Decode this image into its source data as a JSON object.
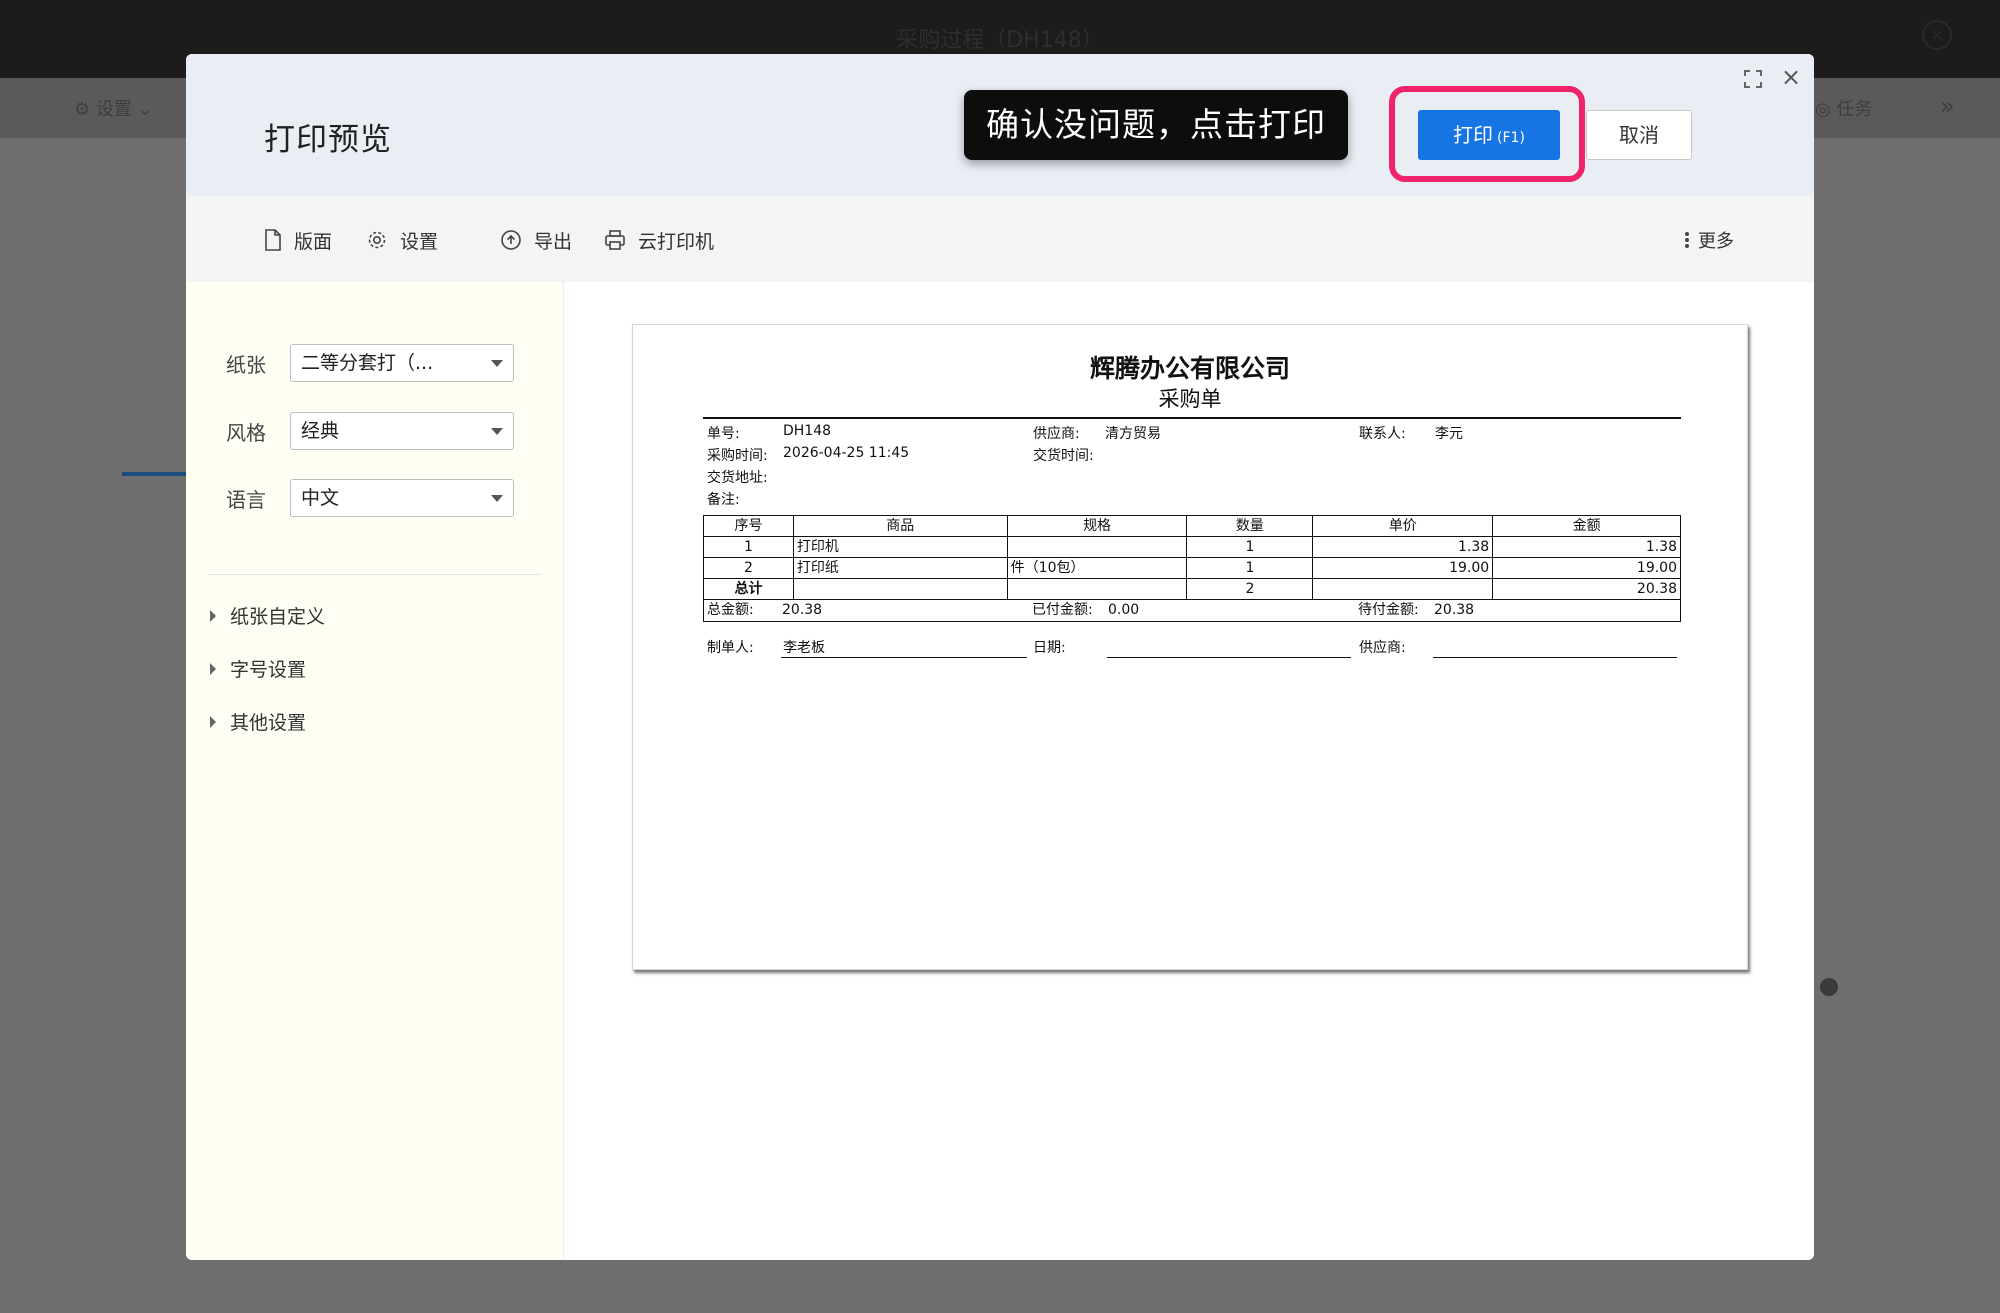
{
  "background": {
    "window_title": "采购过程（DH148）",
    "left_tool": "⚙ 设置 ⌄",
    "right_tool": "◎ 任务"
  },
  "modal": {
    "title": "打印预览",
    "callout": "确认没问题，点击打印",
    "print_label": "打印",
    "print_shortcut": "(F1)",
    "cancel_label": "取消"
  },
  "toolbar": {
    "layout": "版面",
    "settings": "设置",
    "export": "导出",
    "cloud_printer": "云打印机",
    "more": "更多"
  },
  "sidebar": {
    "paper_label": "纸张",
    "paper_value": "二等分套打（...",
    "style_label": "风格",
    "style_value": "经典",
    "language_label": "语言",
    "language_value": "中文",
    "sections": [
      "纸张自定义",
      "字号设置",
      "其他设置"
    ]
  },
  "document": {
    "company": "辉腾办公有限公司",
    "type": "采购单",
    "order_no_label": "单号:",
    "order_no": "DH148",
    "supplier_label": "供应商:",
    "supplier": "清方贸易",
    "contact_label": "联系人:",
    "contact": "李元",
    "purchase_time_label": "采购时间:",
    "purchase_time": "2026-04-25 11:45",
    "delivery_time_label": "交货时间:",
    "delivery_address_label": "交货地址:",
    "remark_label": "备注:",
    "columns": [
      "序号",
      "商品",
      "规格",
      "数量",
      "单价",
      "金额"
    ],
    "rows": [
      [
        "1",
        "打印机",
        "",
        "1",
        "1.38",
        "1.38"
      ],
      [
        "2",
        "打印纸",
        "件（10包）",
        "1",
        "19.00",
        "19.00"
      ]
    ],
    "total_label": "总计",
    "total_qty": "2",
    "total_amount": "20.38",
    "sum_label": "总金额:",
    "sum_value": "20.38",
    "paid_label": "已付金额:",
    "paid_value": "0.00",
    "due_label": "待付金额:",
    "due_value": "20.38",
    "maker_label": "制单人:",
    "maker": "李老板",
    "date_label": "日期:",
    "supplier_sign_label": "供应商:"
  },
  "colors": {
    "primary": "#1674e4",
    "highlight": "#f0246a",
    "header_bg": "#e9eef5",
    "sidebar_bg": "#fffef3"
  }
}
